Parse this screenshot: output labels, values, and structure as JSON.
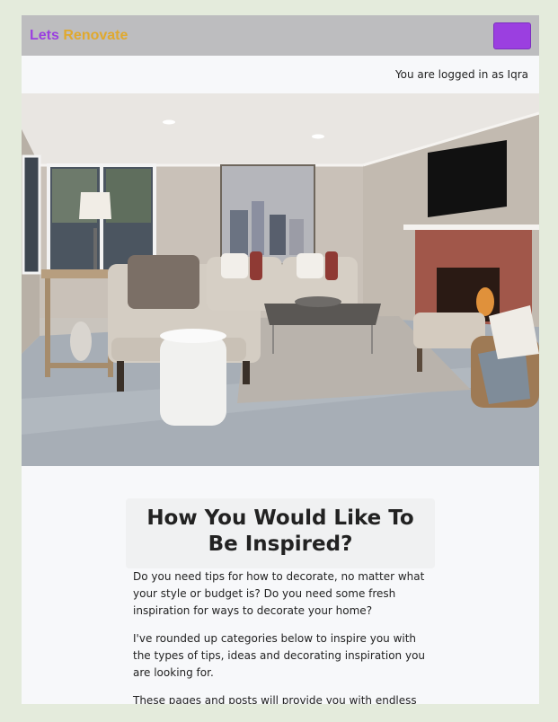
{
  "navbar": {
    "brand_part1": "Lets",
    "brand_part2": "Renovate",
    "toggle_color": "#9b3fe0"
  },
  "user_status": "You are logged in as Iqra",
  "hero": {
    "image_alt": "living room with fireplace"
  },
  "content": {
    "heading": "How You Would Like To Be Inspired?",
    "paragraphs": [
      "Do you need tips for how to decorate, no matter what your style or budget is? Do you need some fresh inspiration for ways to decorate your home?",
      "I've rounded up categories below to inspire you with the types of tips, ideas and decorating inspiration you are looking for.",
      "These pages and posts will provide you with endless affordable and simple ideas for your home! Simply click on any of the"
    ]
  },
  "colors": {
    "brand_purple": "#9b3fe0",
    "brand_gold": "#e0a92e",
    "navbar_bg": "#bdbdbf",
    "page_bg": "#e4ebdc"
  }
}
